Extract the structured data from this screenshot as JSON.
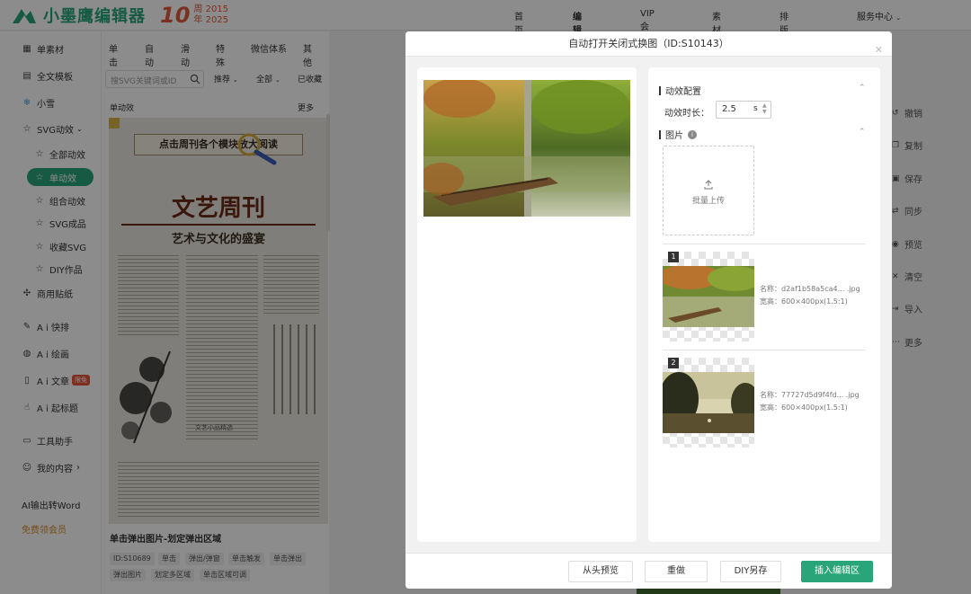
{
  "header": {
    "brand": "小墨鹰编辑器",
    "anniversary_num": "10",
    "anniversary_line1": "周 2015",
    "anniversary_line2": "年 2025",
    "nav": [
      {
        "label": "首页"
      },
      {
        "label": "编辑器"
      },
      {
        "label": "VIP会员"
      },
      {
        "label": "素材库"
      },
      {
        "label": "排版课堂"
      },
      {
        "label": "服务中心"
      }
    ]
  },
  "sidebar": {
    "items": [
      {
        "label": "单素材",
        "icon": "grid-icon"
      },
      {
        "label": "全文模板",
        "icon": "template-icon"
      },
      {
        "label": "小雪",
        "icon": "snowflake-icon"
      },
      {
        "label": "SVG动效",
        "icon": "star-icon"
      },
      {
        "label": "全部动效",
        "icon": "star-icon"
      },
      {
        "label": "单动效",
        "icon": "star-icon"
      },
      {
        "label": "组合动效",
        "icon": "star-icon"
      },
      {
        "label": "SVG成品",
        "icon": "star-icon"
      },
      {
        "label": "收藏SVG",
        "icon": "star-icon"
      },
      {
        "label": "DIY作品",
        "icon": "star-icon"
      },
      {
        "label": "商用贴纸",
        "icon": "puzzle-icon"
      },
      {
        "label": "A i 快排",
        "icon": "ai-icon"
      },
      {
        "label": "A i 绘画",
        "icon": "palette-icon"
      },
      {
        "label": "A i 文章",
        "icon": "document-icon",
        "badge": "限免"
      },
      {
        "label": "A i 起标题",
        "icon": "hand-icon"
      },
      {
        "label": "工具助手",
        "icon": "toolbox-icon"
      },
      {
        "label": "我的内容",
        "icon": "user-icon"
      },
      {
        "label": "AI输出转Word",
        "icon": ""
      },
      {
        "label": "免费领会员",
        "icon": ""
      }
    ]
  },
  "center": {
    "tabs": [
      "单击",
      "自动",
      "滑动",
      "特殊",
      "微信体系",
      "其他"
    ],
    "search_placeholder": "搜SVG关键词或ID",
    "filters": [
      "推荐",
      "全部",
      "已收藏"
    ],
    "section_label": "单动效",
    "more_label": "更多",
    "card": {
      "banner": "点击周刊各个模块放大阅读",
      "title": "文艺周刊",
      "subtitle": "艺术与文化的盛宴",
      "caption": "文艺小品精选"
    },
    "item_title": "单击弹出图片-划定弹出区域",
    "tags": [
      "ID:S10689",
      "单击",
      "弹出/弹窗",
      "单击触发",
      "单击弹出",
      "弹出图片",
      "划定多区域",
      "单击区域可调"
    ]
  },
  "right_toolbar": [
    {
      "label": "撤销",
      "icon": "undo-icon"
    },
    {
      "label": "复制",
      "icon": "copy-icon"
    },
    {
      "label": "保存",
      "icon": "save-icon"
    },
    {
      "label": "同步",
      "icon": "sync-icon"
    },
    {
      "label": "预览",
      "icon": "eye-icon"
    },
    {
      "label": "清空",
      "icon": "trash-icon"
    },
    {
      "label": "导入",
      "icon": "import-icon"
    },
    {
      "label": "更多",
      "icon": "more-icon"
    }
  ],
  "modal": {
    "title": "自动打开关闭式换图（ID:S10143）",
    "section_effect": "动效配置",
    "duration_label": "动效时长：",
    "duration_value": "2.5",
    "duration_unit": "s",
    "section_images": "图片",
    "upload_label": "批量上传",
    "images": [
      {
        "index": "1",
        "name": "名称：d2af1b58a5ca4... .jpg",
        "size": "宽高：600×400px(1.5:1)"
      },
      {
        "index": "2",
        "name": "名称：77727d5d9f4fd... .jpg",
        "size": "宽高：600×400px(1.5:1)"
      }
    ],
    "footer": {
      "btn_preview": "从头预览",
      "btn_redo": "重做",
      "btn_diy": "DIY另存",
      "btn_insert": "插入编辑区"
    }
  },
  "colors": {
    "brand": "#2aa57a",
    "anniversary": "#e05a3a",
    "badge": "#e4543a"
  }
}
